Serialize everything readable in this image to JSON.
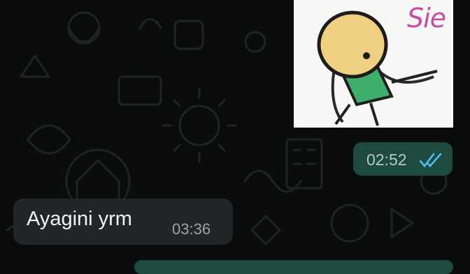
{
  "chat": {
    "wallpaper_icon": "whatsapp-doodle-wallpaper",
    "accent_outgoing": "#1f4a3f",
    "accent_incoming": "#232628",
    "messages": [
      {
        "direction": "outgoing",
        "kind": "sticker",
        "sticker_text": "Sie",
        "sticker_icon": "cartoon-kid-sticker"
      },
      {
        "direction": "outgoing",
        "kind": "status",
        "time": "02:52",
        "status_icon": "double-check-read-icon",
        "status_color": "#53bdeb"
      },
      {
        "direction": "incoming",
        "kind": "text",
        "text": "Ayagini yrm",
        "time": "03:36"
      },
      {
        "direction": "outgoing",
        "kind": "partial"
      }
    ]
  }
}
